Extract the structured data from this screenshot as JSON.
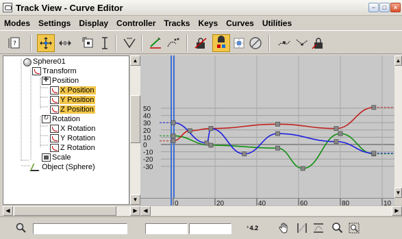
{
  "window": {
    "title": "Track View - Curve Editor",
    "buttons": {
      "minimize": "−",
      "maximize": "□",
      "close": "×"
    }
  },
  "menu": [
    "Modes",
    "Settings",
    "Display",
    "Controller",
    "Tracks",
    "Keys",
    "Curves",
    "Utilities"
  ],
  "tree": [
    {
      "label": "Sphere01",
      "icon": "sphere-icon",
      "selected": false
    },
    {
      "label": "Transform",
      "icon": "transform-icon",
      "selected": false
    },
    {
      "label": "Position",
      "icon": "position-icon",
      "selected": false
    },
    {
      "label": "X Position",
      "icon": "curve-icon",
      "selected": true
    },
    {
      "label": "Y Position",
      "icon": "curve-icon",
      "selected": true
    },
    {
      "label": "Z Position",
      "icon": "curve-icon",
      "selected": true
    },
    {
      "label": "Rotation",
      "icon": "rotation-icon",
      "selected": false
    },
    {
      "label": "X Rotation",
      "icon": "curve-icon",
      "selected": false
    },
    {
      "label": "Y Rotation",
      "icon": "curve-icon",
      "selected": false
    },
    {
      "label": "Z Rotation",
      "icon": "curve-icon",
      "selected": false
    },
    {
      "label": "Scale",
      "icon": "scale-icon",
      "selected": false
    },
    {
      "label": "Object (Sphere)",
      "icon": "object-icon",
      "selected": false
    }
  ],
  "graph": {
    "y_ticks": [
      "50",
      "40",
      "30",
      "20",
      "10",
      "0",
      "-10",
      "-20",
      "-30"
    ],
    "x_ticks": [
      "0",
      "20",
      "40",
      "60",
      "80",
      "10"
    ],
    "current_frame": 0,
    "colors": {
      "x": "#c0201c",
      "y": "#2020e0",
      "z": "#109010",
      "key": "#888888",
      "background": "#c8c8c8"
    },
    "curves": {
      "x": [
        [
          0,
          5
        ],
        [
          8,
          19
        ],
        [
          18,
          22
        ],
        [
          50,
          28
        ],
        [
          78,
          22
        ],
        [
          96,
          51
        ]
      ],
      "y": [
        [
          0,
          30
        ],
        [
          16,
          2
        ],
        [
          18,
          22
        ],
        [
          34,
          -13
        ],
        [
          50,
          15
        ],
        [
          78,
          4
        ],
        [
          96,
          -12
        ]
      ],
      "z": [
        [
          0,
          12
        ],
        [
          18,
          -1
        ],
        [
          50,
          -5
        ],
        [
          62,
          -33
        ],
        [
          80,
          15
        ],
        [
          96,
          -13
        ]
      ]
    }
  },
  "status": {
    "zoom_value": "4.2",
    "field1": "",
    "field2": "",
    "field3": ""
  }
}
